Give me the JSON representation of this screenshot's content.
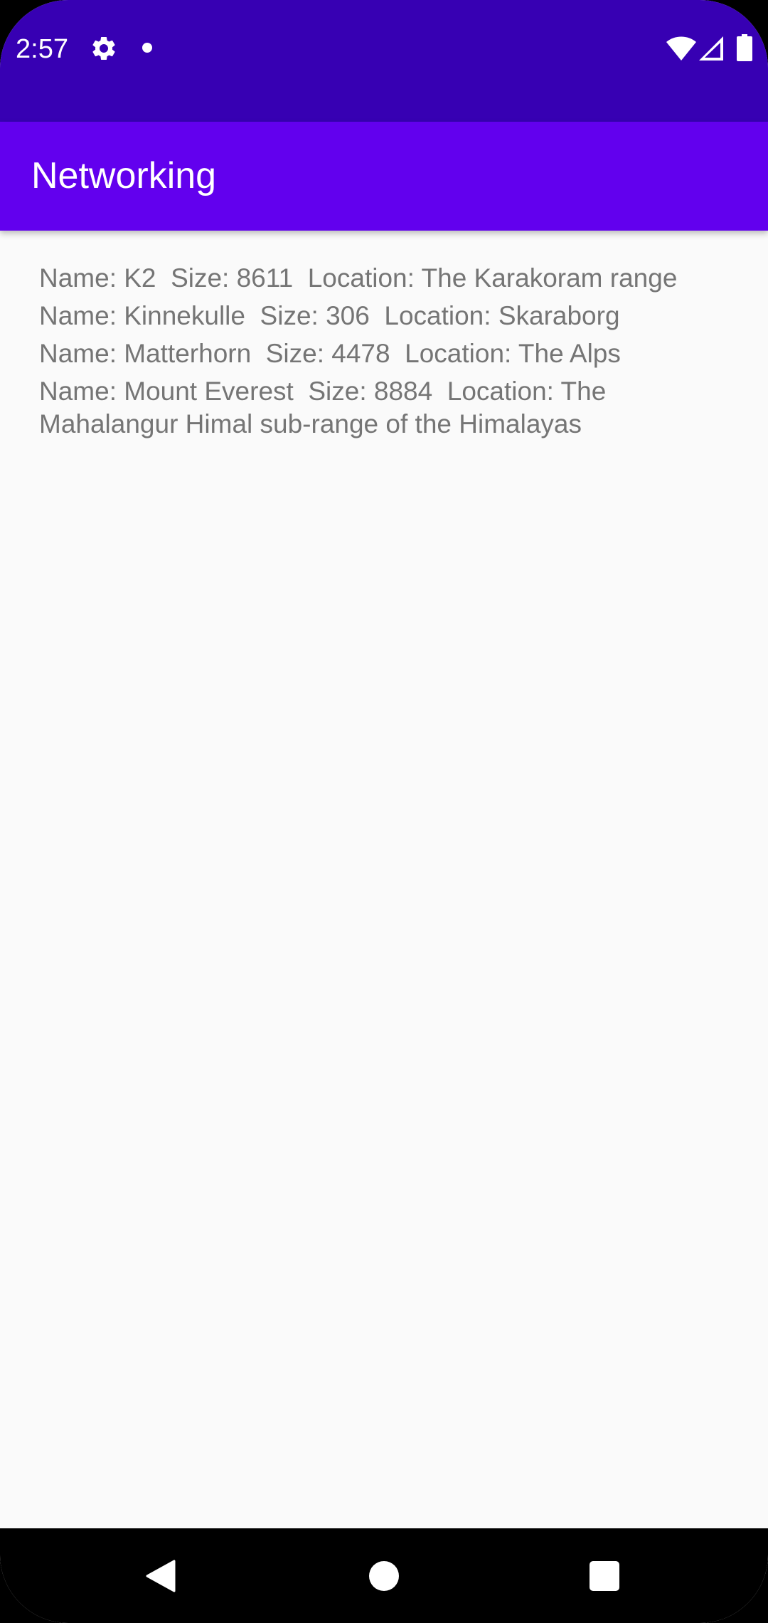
{
  "status_bar": {
    "time": "2:57",
    "icons": [
      "gear-icon",
      "notification-dot-icon",
      "wifi-icon",
      "cell-signal-icon",
      "battery-icon"
    ]
  },
  "app_bar": {
    "title": "Networking"
  },
  "list": {
    "items": [
      "Name: K2  Size: 8611  Location: The Karakoram range",
      "Name: Kinnekulle  Size: 306  Location: Skaraborg",
      "Name: Matterhorn  Size: 4478  Location: The Alps",
      "Name: Mount Everest  Size: 8884  Location: The Mahalangur Himal sub-range of the Himalayas"
    ]
  },
  "nav_bar": {
    "icons": [
      "back-icon",
      "home-icon",
      "recents-icon"
    ]
  },
  "colors": {
    "status_bar": "#3700b3",
    "app_bar": "#6200ee",
    "background": "#fafafa",
    "list_text": "#757575"
  }
}
